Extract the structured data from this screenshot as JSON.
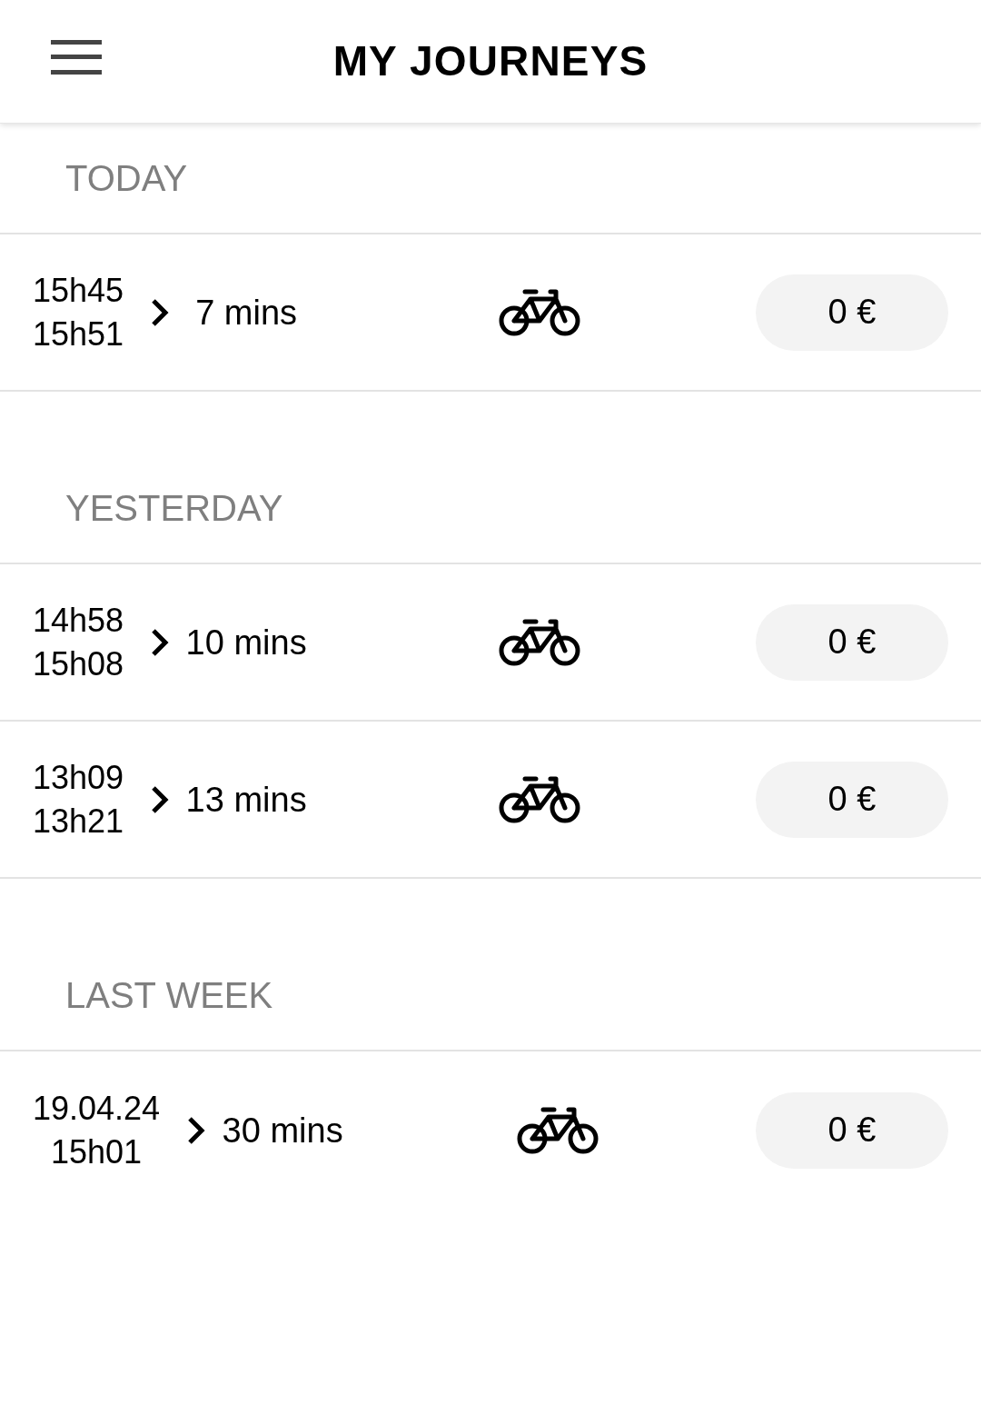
{
  "header": {
    "title": "MY JOURNEYS"
  },
  "sections": [
    {
      "title": "TODAY",
      "journeys": [
        {
          "start": "15h45",
          "end": "15h51",
          "duration": "7 mins",
          "price": "0 €"
        }
      ]
    },
    {
      "title": "YESTERDAY",
      "journeys": [
        {
          "start": "14h58",
          "end": "15h08",
          "duration": "10 mins",
          "price": "0 €"
        },
        {
          "start": "13h09",
          "end": "13h21",
          "duration": "13 mins",
          "price": "0 €"
        }
      ]
    },
    {
      "title": "LAST WEEK",
      "journeys": [
        {
          "start": "19.04.24",
          "end": "15h01",
          "duration": "30 mins",
          "price": "0 €"
        }
      ]
    }
  ]
}
